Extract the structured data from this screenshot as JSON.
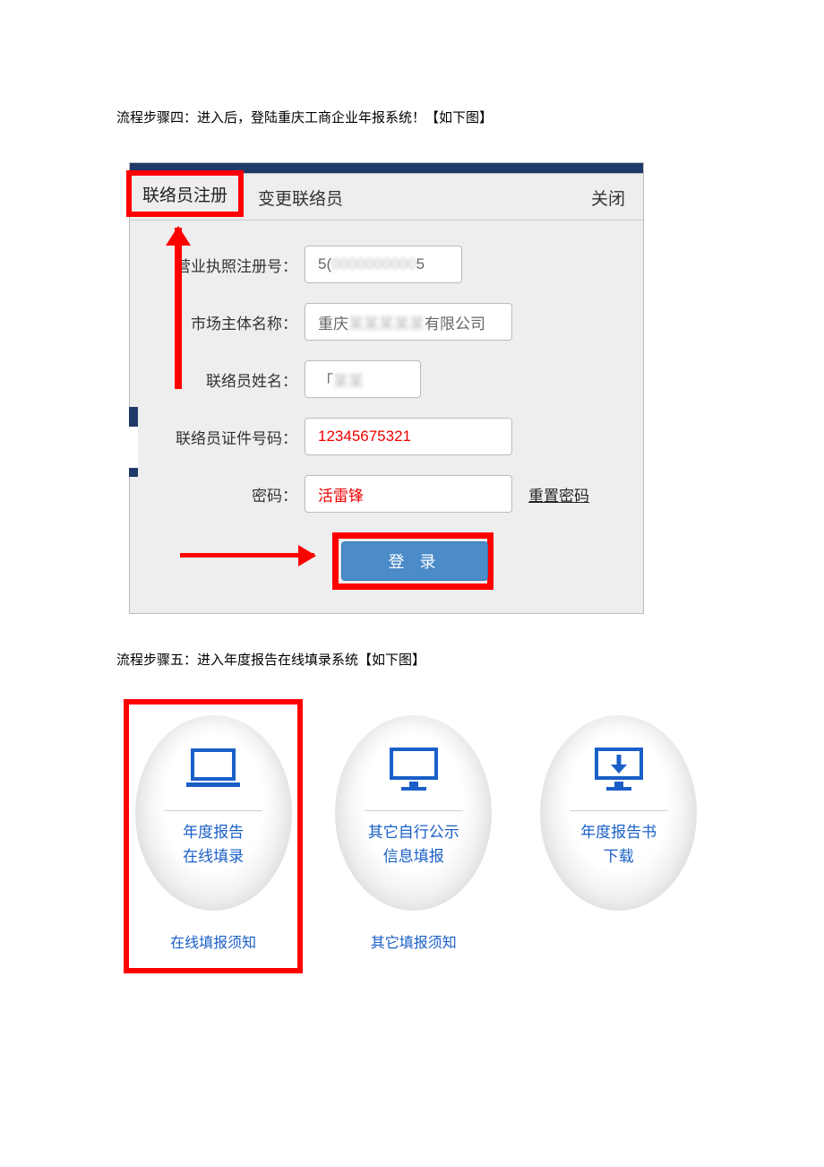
{
  "step4_text": "流程步骤四：进入后，登陆重庆工商企业年报系统！【如下图】",
  "step5_text": "流程步骤五：进入年度报告在线填录系统【如下图】",
  "login": {
    "tab_register": "联络员注册",
    "tab_change": "变更联络员",
    "close": "关闭",
    "label_license": "营业执照注册号：",
    "value_license_prefix": "5(",
    "value_license_suffix": "5",
    "label_entity": "市场主体名称：",
    "value_entity_prefix": "重庆",
    "value_entity_suffix": "有限公司",
    "label_contact_name": "联络员姓名：",
    "value_contact_name": "「",
    "label_id": "联络员证件号码：",
    "value_id": "12345675321",
    "label_password": "密码：",
    "value_password": "活雷锋",
    "reset_link": "重置密码",
    "login_button": "登 录"
  },
  "cards": {
    "c1_line1": "年度报告",
    "c1_line2": "在线填录",
    "c1_sub": "在线填报须知",
    "c2_line1": "其它自行公示",
    "c2_line2": "信息填报",
    "c2_sub": "其它填报须知",
    "c3_line1": "年度报告书",
    "c3_line2": "下载"
  }
}
